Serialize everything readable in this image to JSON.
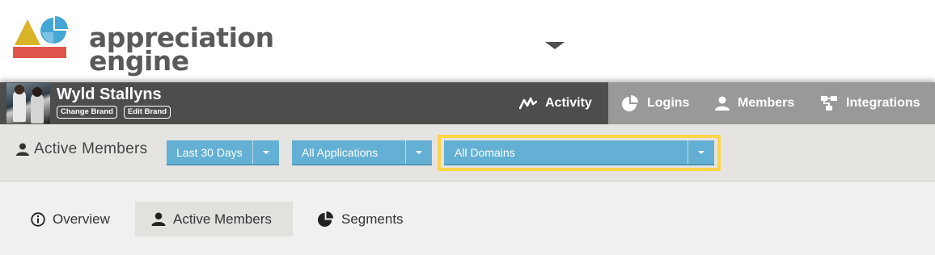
{
  "logo": {
    "line1": "appreciation",
    "line2": "engine",
    "icon": "appreciation-engine-logo"
  },
  "brand": {
    "name": "Wyld Stallyns",
    "change_label": "Change Brand",
    "edit_label": "Edit Brand",
    "avatar": "band-photo"
  },
  "nav": {
    "tabs": [
      {
        "label": "Activity",
        "icon": "activity-chart-icon",
        "active": true
      },
      {
        "label": "Logins",
        "icon": "pie-chart-icon"
      },
      {
        "label": "Members",
        "icon": "user-icon"
      },
      {
        "label": "Integrations",
        "icon": "sitemap-icon"
      }
    ]
  },
  "filters": {
    "section_title": "Active Members",
    "date_range": "Last 30 Days",
    "applications": "All Applications",
    "domains": "All Domains"
  },
  "subnav": {
    "tabs": [
      {
        "label": "Overview",
        "icon": "info-circle-icon"
      },
      {
        "label": "Active Members",
        "icon": "user-icon",
        "active": true
      },
      {
        "label": "Segments",
        "icon": "pie-chart-icon"
      }
    ]
  },
  "colors": {
    "brand_bar": "#4d4d4d",
    "nav_inactive": "#999999",
    "dropdown": "#64b0d4",
    "highlight": "#fdd54a",
    "logo_yellow": "#d9b426",
    "logo_blue": "#44a7d6",
    "logo_red": "#e0554b"
  }
}
